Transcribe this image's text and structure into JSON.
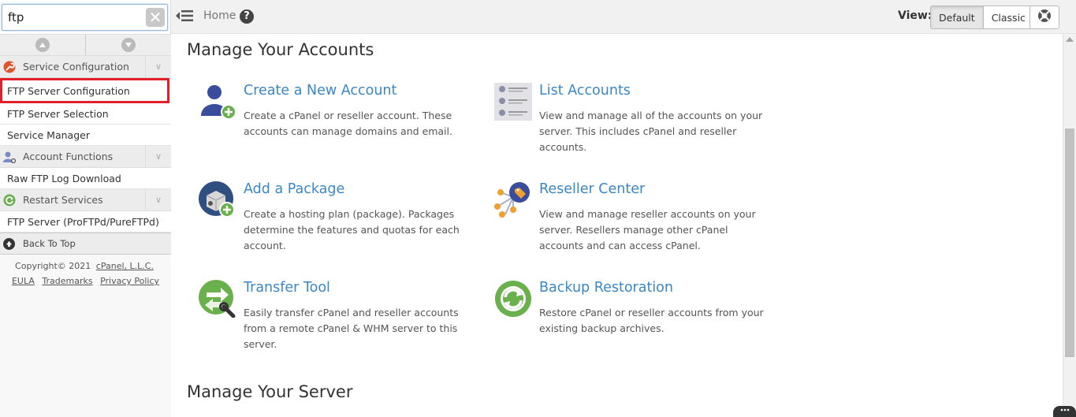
{
  "search": {
    "value": "ftp",
    "clear_symbol": "✕"
  },
  "sidebar": {
    "categories": [
      {
        "label": "Service Configuration",
        "chev": "∨"
      },
      {
        "label": "Account Functions",
        "chev": "∨"
      },
      {
        "label": "Restart Services",
        "chev": "∨"
      }
    ],
    "items": [
      "FTP Server Configuration",
      "FTP Server Selection",
      "Service Manager",
      "Raw FTP Log Download",
      "FTP Server (ProFTPd/PureFTPd)"
    ],
    "back_to_top": "Back To Top",
    "footer": {
      "copyright": "Copyright© 2021",
      "company": "cPanel, L.L.C.",
      "links": [
        "EULA",
        "Trademarks",
        "Privacy Policy"
      ]
    }
  },
  "topbar": {
    "home": "Home",
    "help": "?",
    "view_label": "View:",
    "view_default": "Default",
    "view_classic": "Classic"
  },
  "main": {
    "section1": "Manage Your Accounts",
    "section2": "Manage Your Server",
    "cards": [
      {
        "title": "Create a New Account",
        "desc": "Create a cPanel or reseller account. These accounts can manage domains and email."
      },
      {
        "title": "List Accounts",
        "desc": "View and manage all of the accounts on your server. This includes cPanel and reseller accounts."
      },
      {
        "title": "Add a Package",
        "desc": "Create a hosting plan (package). Packages determine the features and quotas for each account."
      },
      {
        "title": "Reseller Center",
        "desc": "View and manage reseller accounts on your server. Resellers manage other cPanel accounts and can access cPanel."
      },
      {
        "title": "Transfer Tool",
        "desc": "Easily transfer cPanel and reseller accounts from a remote cPanel & WHM server to this server."
      },
      {
        "title": "Backup Restoration",
        "desc": "Restore cPanel or reseller accounts from your existing backup archives."
      }
    ]
  },
  "colors": {
    "link_blue": "#3a87c6",
    "selected_border": "#e2202a",
    "icon_green": "#6ab04c",
    "icon_navy": "#3a5a8c"
  }
}
